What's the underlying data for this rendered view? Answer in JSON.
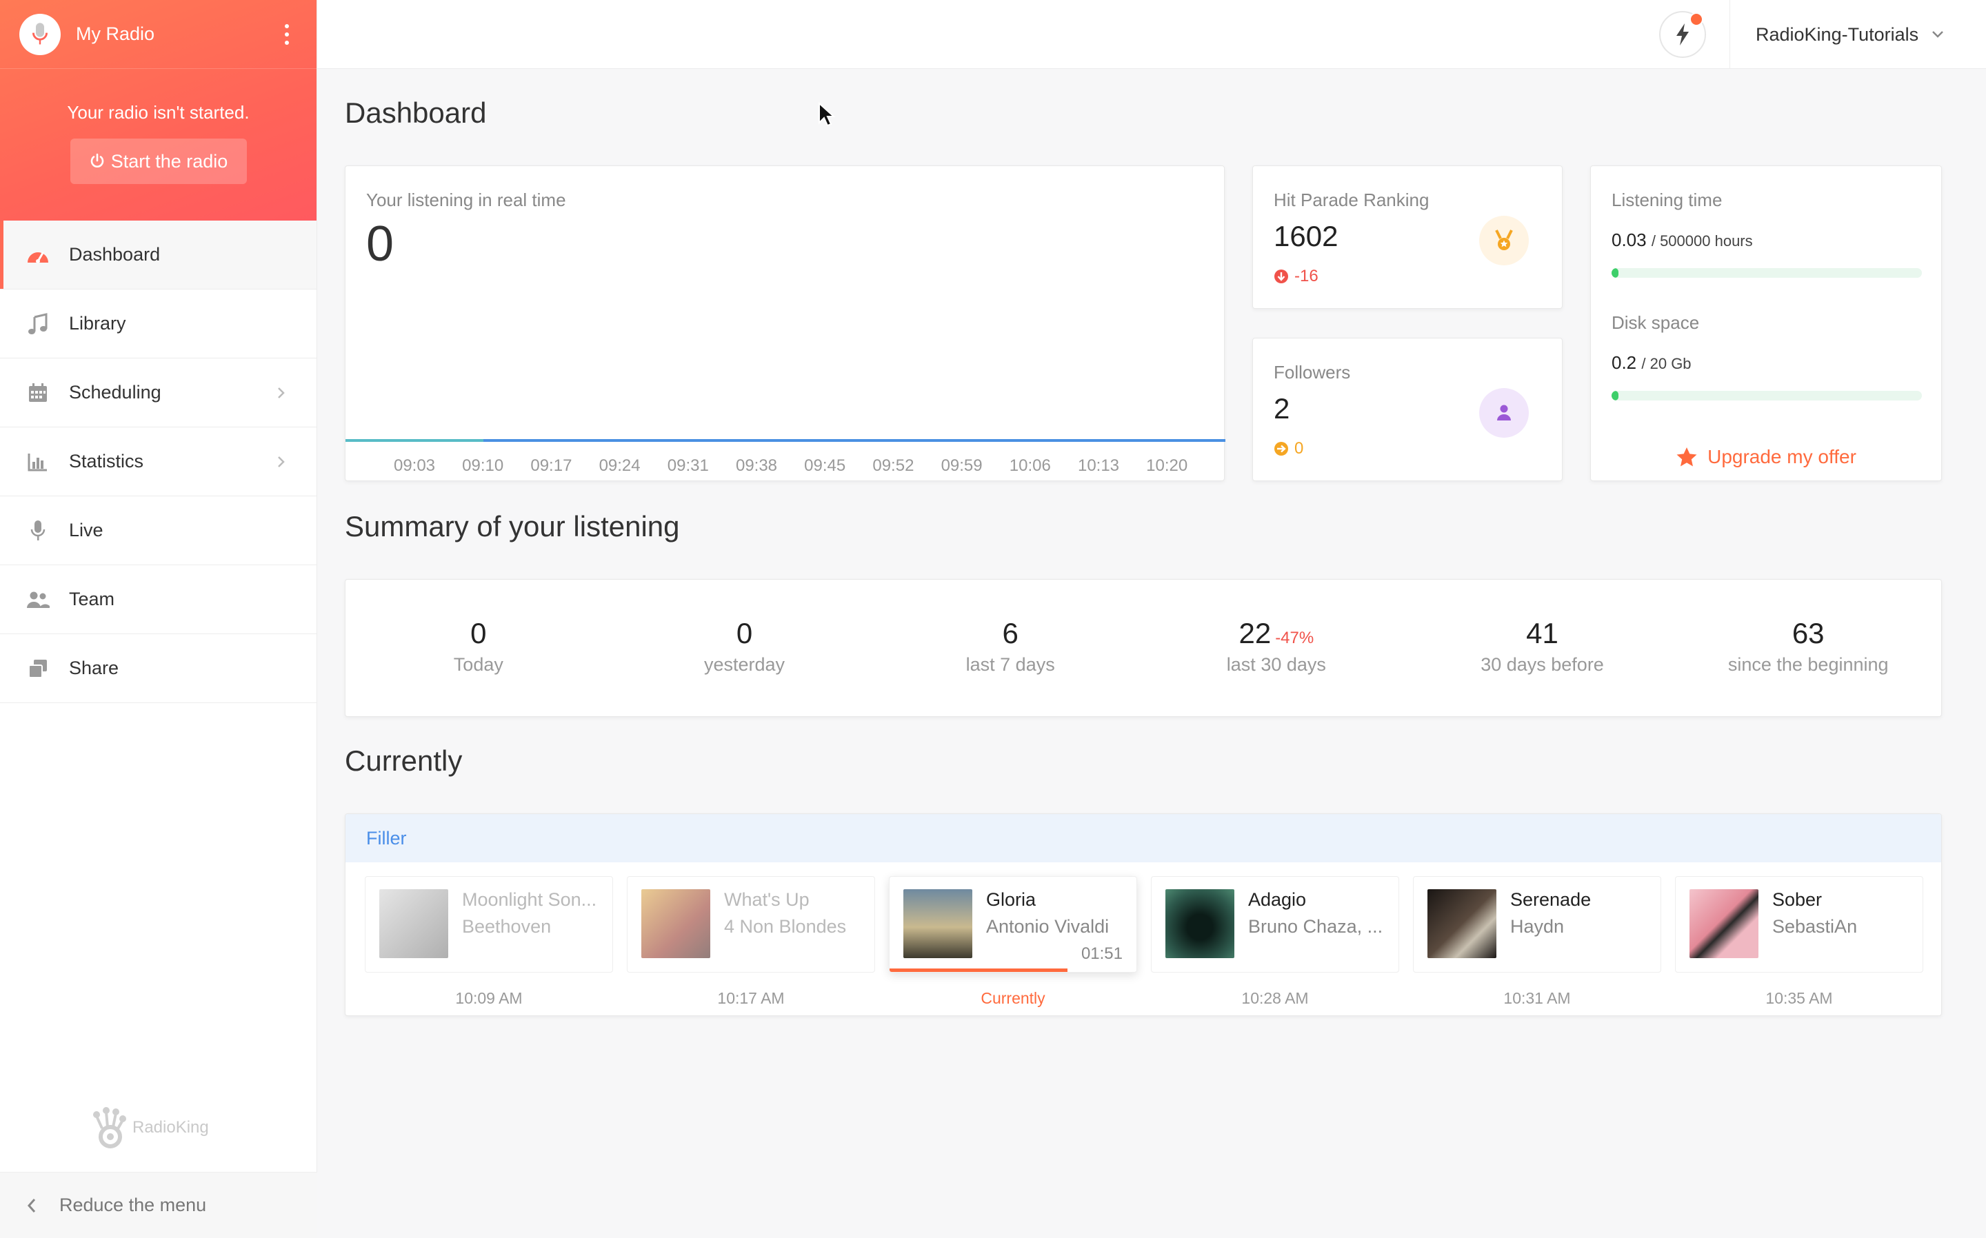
{
  "sidebar": {
    "radio_name": "My Radio",
    "status_text": "Your radio isn't started.",
    "start_label": "Start the radio",
    "items": [
      {
        "label": "Dashboard",
        "icon": "gauge-icon",
        "active": true
      },
      {
        "label": "Library",
        "icon": "music-note-icon"
      },
      {
        "label": "Scheduling",
        "icon": "calendar-icon",
        "has_children": true
      },
      {
        "label": "Statistics",
        "icon": "bar-chart-icon",
        "has_children": true
      },
      {
        "label": "Live",
        "icon": "microphone-icon"
      },
      {
        "label": "Team",
        "icon": "users-icon"
      },
      {
        "label": "Share",
        "icon": "share-icon"
      }
    ],
    "brand_logo": "RadioKing",
    "reduce_label": "Reduce the menu"
  },
  "topbar": {
    "account_name": "RadioKing-Tutorials"
  },
  "dashboard": {
    "title": "Dashboard",
    "realtime": {
      "label": "Your listening in real time",
      "value": "0",
      "times": [
        "09:03",
        "09:10",
        "09:17",
        "09:24",
        "09:31",
        "09:38",
        "09:45",
        "09:52",
        "09:59",
        "10:06",
        "10:13",
        "10:20"
      ]
    },
    "hit_parade": {
      "label": "Hit Parade Ranking",
      "value": "1602",
      "delta": "-16"
    },
    "followers": {
      "label": "Followers",
      "value": "2",
      "delta": "0"
    },
    "listening_time": {
      "label": "Listening time",
      "used": "0.03",
      "total": "/ 500000 hours",
      "fraction": 1e-07
    },
    "disk_space": {
      "label": "Disk space",
      "used": "0.2",
      "total": "/ 20 Gb",
      "fraction": 0.01
    },
    "upgrade_label": "Upgrade my offer"
  },
  "summary": {
    "title": "Summary of your listening",
    "stats": [
      {
        "value": "0",
        "label": "Today"
      },
      {
        "value": "0",
        "label": "yesterday"
      },
      {
        "value": "6",
        "label": "last 7 days"
      },
      {
        "value": "22",
        "label": "last 30 days",
        "delta": "-47%"
      },
      {
        "value": "41",
        "label": "30 days before"
      },
      {
        "value": "63",
        "label": "since the beginning"
      }
    ]
  },
  "currently": {
    "title": "Currently",
    "playlist": "Filler",
    "tracks": [
      {
        "title": "Moonlight Son...",
        "artist": "Beethoven",
        "time": "10:09 AM",
        "state": "past",
        "cover": "#9a9a9a"
      },
      {
        "title": "What's Up",
        "artist": "4 Non Blondes",
        "time": "10:17 AM",
        "state": "past",
        "cover": "#b8442c"
      },
      {
        "title": "Gloria",
        "artist": "Antonio Vivaldi",
        "time": "Currently",
        "state": "now",
        "duration": "01:51",
        "progress": 0.72,
        "cover": "#8a8f7a"
      },
      {
        "title": "Adagio",
        "artist": "Bruno Chaza, ...",
        "time": "10:28 AM",
        "state": "next",
        "cover": "#2e5a4d"
      },
      {
        "title": "Serenade",
        "artist": "Haydn",
        "time": "10:31 AM",
        "state": "next",
        "cover": "#2a2522"
      },
      {
        "title": "Sober",
        "artist": "SebastiAn",
        "time": "10:35 AM",
        "state": "next",
        "cover": "#e8a1ac"
      }
    ]
  },
  "colors": {
    "accent": "#ff6a3d",
    "sidebar_gradient_start": "#ff7a55",
    "sidebar_gradient_end": "#ff5a5f",
    "positive": "#3ecf6a",
    "negative": "#f0524a",
    "info": "#4a8ee8"
  }
}
